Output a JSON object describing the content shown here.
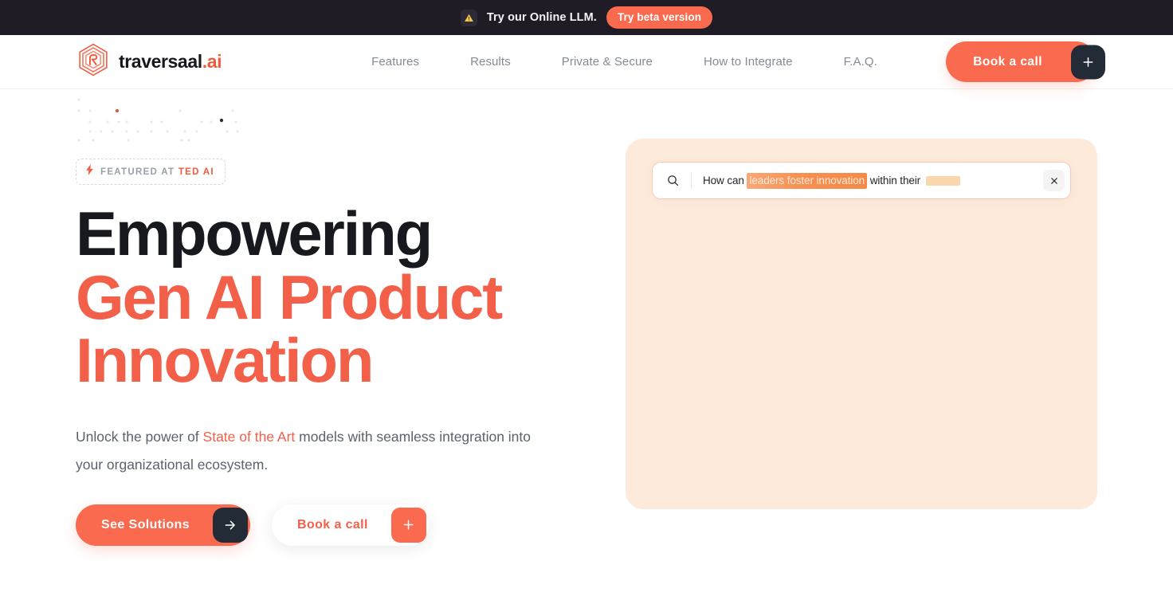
{
  "announcement": {
    "icon": "warning-triangle-icon",
    "text": "Try our Online LLM.",
    "cta_label": "Try beta version"
  },
  "header": {
    "logo": {
      "icon": "traversaal-hex-logo-icon",
      "name": "traversaal",
      "suffix": ".ai"
    },
    "nav": [
      {
        "label": "Features"
      },
      {
        "label": "Results"
      },
      {
        "label": "Private & Secure"
      },
      {
        "label": "How to Integrate"
      },
      {
        "label": "F.A.Q."
      }
    ],
    "cta": {
      "label": "Book a call",
      "badge_icon": "plus-icon"
    }
  },
  "hero": {
    "badge": {
      "icon": "lightning-bolt-icon",
      "prefix": "FEATURED AT",
      "highlight": "TED AI"
    },
    "headline_line1": "Empowering",
    "headline_line2": "Gen AI Product",
    "headline_line3": "Innovation",
    "subtitle_part1": "Unlock the power of ",
    "subtitle_accent": "State of the Art",
    "subtitle_part2": " models with seamless integration into your organizational ecosystem.",
    "primary_cta": {
      "label": "See Solutions",
      "badge_icon": "arrow-right-icon"
    },
    "secondary_cta": {
      "label": "Book a call",
      "badge_icon": "plus-icon"
    }
  },
  "demo": {
    "search": {
      "icon": "search-icon",
      "query_prefix": "How can ",
      "query_highlight": "leaders foster innovation",
      "query_suffix": " within their ",
      "clear_icon": "close-icon"
    }
  },
  "colors": {
    "accent": "#f2604a",
    "accent_button": "#f96a4f",
    "dark": "#201c26",
    "panel_bg": "#fdeadb",
    "nav_text": "#848b97",
    "warning": "#f5c63f"
  }
}
